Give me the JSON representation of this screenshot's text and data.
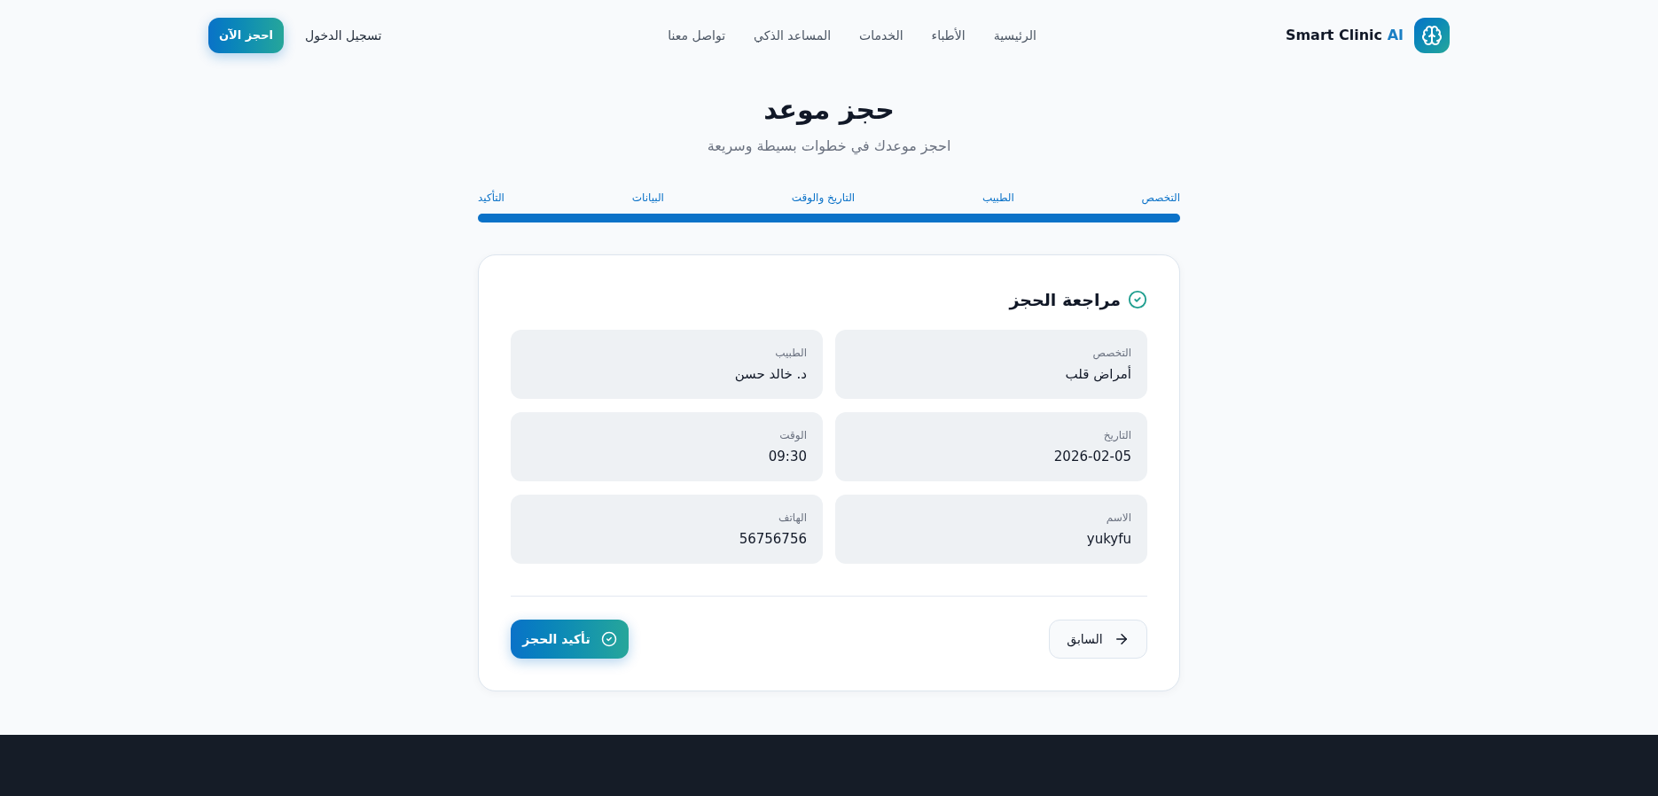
{
  "header": {
    "logo": {
      "name": "Smart Clinic",
      "accent": "AI"
    },
    "nav": [
      {
        "label": "الرئيسية"
      },
      {
        "label": "الأطباء"
      },
      {
        "label": "الخدمات"
      },
      {
        "label": "المساعد الذكي"
      },
      {
        "label": "تواصل معنا"
      }
    ],
    "login": "تسجيل الدخول",
    "cta": "احجز الآن"
  },
  "intro": {
    "title": "حجز موعد",
    "subtitle": "احجز موعدك في خطوات بسيطة وسريعة"
  },
  "steps": {
    "items": [
      {
        "label": "التخصص",
        "active": true
      },
      {
        "label": "الطبيب",
        "active": true
      },
      {
        "label": "التاريخ والوقت",
        "active": true
      },
      {
        "label": "البيانات",
        "active": true
      },
      {
        "label": "التأكيد",
        "active": true
      }
    ],
    "level": 1
  },
  "review": {
    "title": "مراجعة الحجز",
    "fields": [
      {
        "label": "التخصص",
        "value": "أمراض قلب"
      },
      {
        "label": "الطبيب",
        "value": "د. خالد حسن"
      },
      {
        "label": "التاريخ",
        "value": "2026-02-05"
      },
      {
        "label": "الوقت",
        "value": "09:30"
      },
      {
        "label": "الاسم",
        "value": "yukyfu"
      },
      {
        "label": "الهاتف",
        "value": "56756756"
      }
    ]
  },
  "actions": {
    "previous": "السابق",
    "confirm": "تأكيد الحجز"
  }
}
